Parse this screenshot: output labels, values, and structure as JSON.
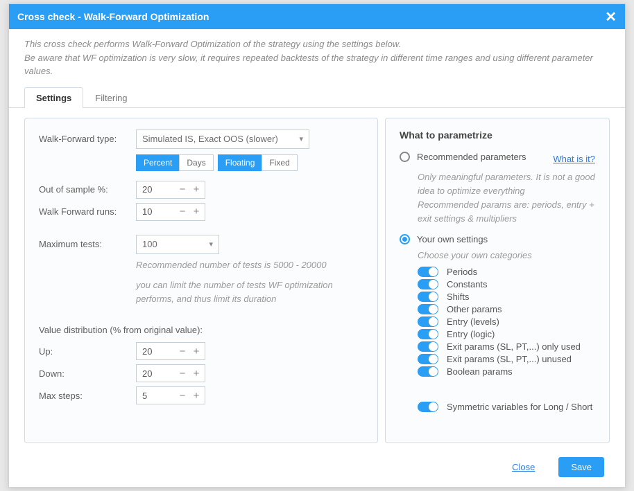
{
  "title": "Cross check - Walk-Forward Optimization",
  "description1": "This cross check performs Walk-Forward Optimization of the strategy using the settings below.",
  "description2": "Be aware that WF optimization is very slow, it requires repeated backtests of the strategy in different time ranges and using different parameter values.",
  "tabs": {
    "settings": "Settings",
    "filtering": "Filtering"
  },
  "left": {
    "wf_type_label": "Walk-Forward type:",
    "wf_type_value": "Simulated IS, Exact OOS (slower)",
    "strip": {
      "percent": "Percent",
      "days": "Days",
      "floating": "Floating",
      "fixed": "Fixed"
    },
    "oos_label": "Out of sample %:",
    "oos_value": "20",
    "runs_label": "Walk Forward runs:",
    "runs_value": "10",
    "max_tests_label": "Maximum tests:",
    "max_tests_value": "100",
    "max_tests_hint": "Recommended number of tests is 5000 - 20000",
    "max_tests_hint2": "you can limit the number of tests WF optimization performs, and thus limit its duration",
    "dist_heading": "Value distribution (% from original value):",
    "up_label": "Up:",
    "up_value": "20",
    "down_label": "Down:",
    "down_value": "20",
    "steps_label": "Max steps:",
    "steps_value": "5"
  },
  "right": {
    "heading": "What to parametrize",
    "what_is_it": "What is it?",
    "recommended_label": "Recommended parameters",
    "recommended_hint": "Only meaningful parameters. It is not a good idea to optimize everything\nRecommended params are: periods, entry + exit settings & multipliers",
    "own_label": "Your own settings",
    "own_hint": "Choose your own categories",
    "toggles": [
      "Periods",
      "Constants",
      "Shifts",
      "Other params",
      "Entry (levels)",
      "Entry (logic)",
      "Exit params (SL, PT,...) only used",
      "Exit params (SL, PT,...) unused",
      "Boolean params"
    ],
    "symmetric": "Symmetric variables for Long / Short"
  },
  "footer": {
    "close": "Close",
    "save": "Save"
  }
}
